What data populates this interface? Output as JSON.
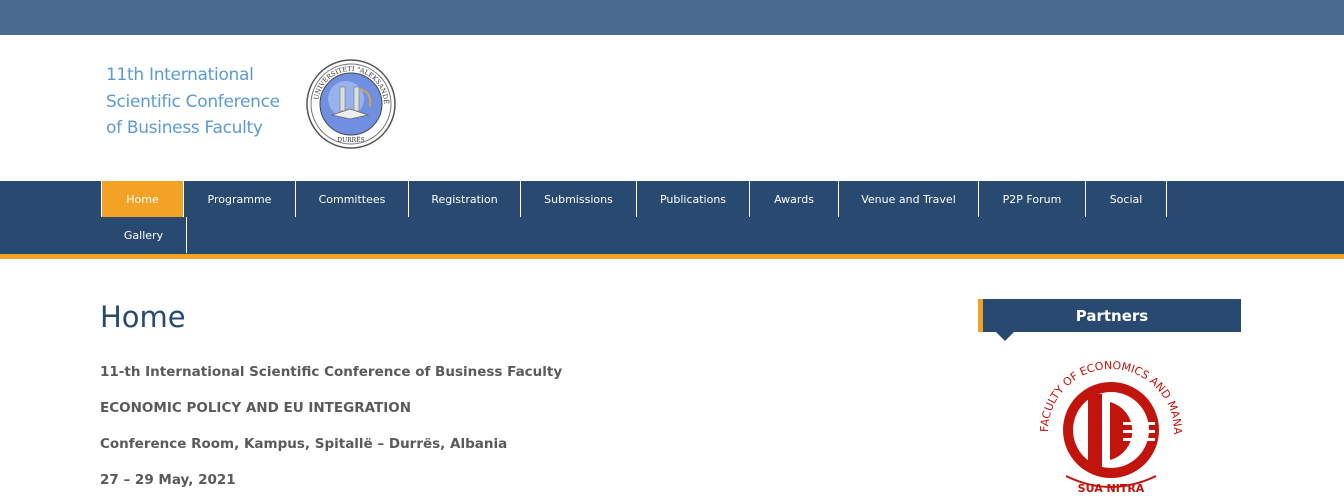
{
  "site": {
    "logo_text_lines": [
      "11th International",
      "Scientific Conference",
      "of Business Faculty"
    ],
    "seal_label": "Universiteti Aleksandër Moisiu Durrës"
  },
  "nav": {
    "items": [
      {
        "label": "Home",
        "active": true
      },
      {
        "label": "Programme",
        "active": false
      },
      {
        "label": "Committees",
        "active": false
      },
      {
        "label": "Registration",
        "active": false
      },
      {
        "label": "Submissions",
        "active": false
      },
      {
        "label": "Publications",
        "active": false
      },
      {
        "label": "Awards",
        "active": false
      },
      {
        "label": "Venue and Travel",
        "active": false
      },
      {
        "label": "P2P Forum",
        "active": false
      },
      {
        "label": "Social",
        "active": false
      },
      {
        "label": "Gallery",
        "active": false
      }
    ]
  },
  "main": {
    "title": "Home",
    "paragraphs": [
      "11-th International Scientific Conference of Business Faculty",
      "ECONOMIC POLICY AND EU INTEGRATION",
      "Conference Room, Kampus, Spitallë – Durrës, Albania",
      "27 – 29 May, 2021"
    ]
  },
  "sidebar": {
    "partners_title": "Partners",
    "partner_logo_text_top": "FACULTY OF ECONOMICS AND MANAGEMENT",
    "partner_logo_text_bottom": "SUA NITRA"
  },
  "colors": {
    "top_bar": "#4a6a8f",
    "nav_bg": "#294a70",
    "accent": "#f4a226",
    "logo_text": "#5b9bd5",
    "partner_red": "#c0140c"
  }
}
